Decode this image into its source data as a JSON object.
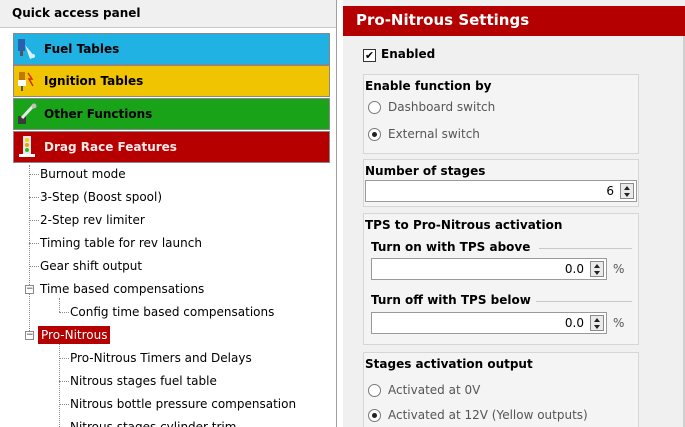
{
  "left_panel": {
    "title": "Quick access panel",
    "categories": [
      {
        "label": "Fuel Tables",
        "color": "#1fb2e2"
      },
      {
        "label": "Ignition Tables",
        "color": "#f0c400"
      },
      {
        "label": "Other Functions",
        "color": "#19a319"
      },
      {
        "label": "Drag Race Features",
        "color": "#b60000"
      }
    ],
    "tree": [
      {
        "label": "Burnout mode"
      },
      {
        "label": "3-Step (Boost spool)"
      },
      {
        "label": "2-Step rev limiter"
      },
      {
        "label": "Timing table for rev launch"
      },
      {
        "label": "Gear shift output"
      },
      {
        "label": "Time based compensations",
        "expander": "−"
      },
      {
        "label": "Config time based compensations"
      },
      {
        "label": "Pro-Nitrous",
        "expander": "−",
        "selected": true
      },
      {
        "label": "Pro-Nitrous Timers and Delays"
      },
      {
        "label": "Nitrous stages fuel table"
      },
      {
        "label": "Nitrous bottle pressure compensation"
      },
      {
        "label": "Nitrous stages cylinder trim"
      }
    ]
  },
  "right_panel": {
    "title": "Pro-Nitrous Settings",
    "enabled": {
      "label": "Enabled",
      "checked": true
    },
    "enable_function": {
      "title": "Enable function by",
      "options": [
        {
          "label": "Dashboard switch",
          "selected": false
        },
        {
          "label": "External switch",
          "selected": true
        }
      ]
    },
    "stages": {
      "title": "Number of stages",
      "value": "6"
    },
    "tps": {
      "title": "TPS to Pro-Nitrous activation",
      "turn_on": {
        "label": "Turn on with TPS above",
        "value": "0.0",
        "unit": "%"
      },
      "turn_off": {
        "label": "Turn off with TPS below",
        "value": "0.0",
        "unit": "%"
      }
    },
    "output": {
      "title": "Stages activation output",
      "options": [
        {
          "label": "Activated at 0V",
          "selected": false
        },
        {
          "label": "Activated at 12V (Yellow outputs)",
          "selected": true
        }
      ]
    }
  }
}
